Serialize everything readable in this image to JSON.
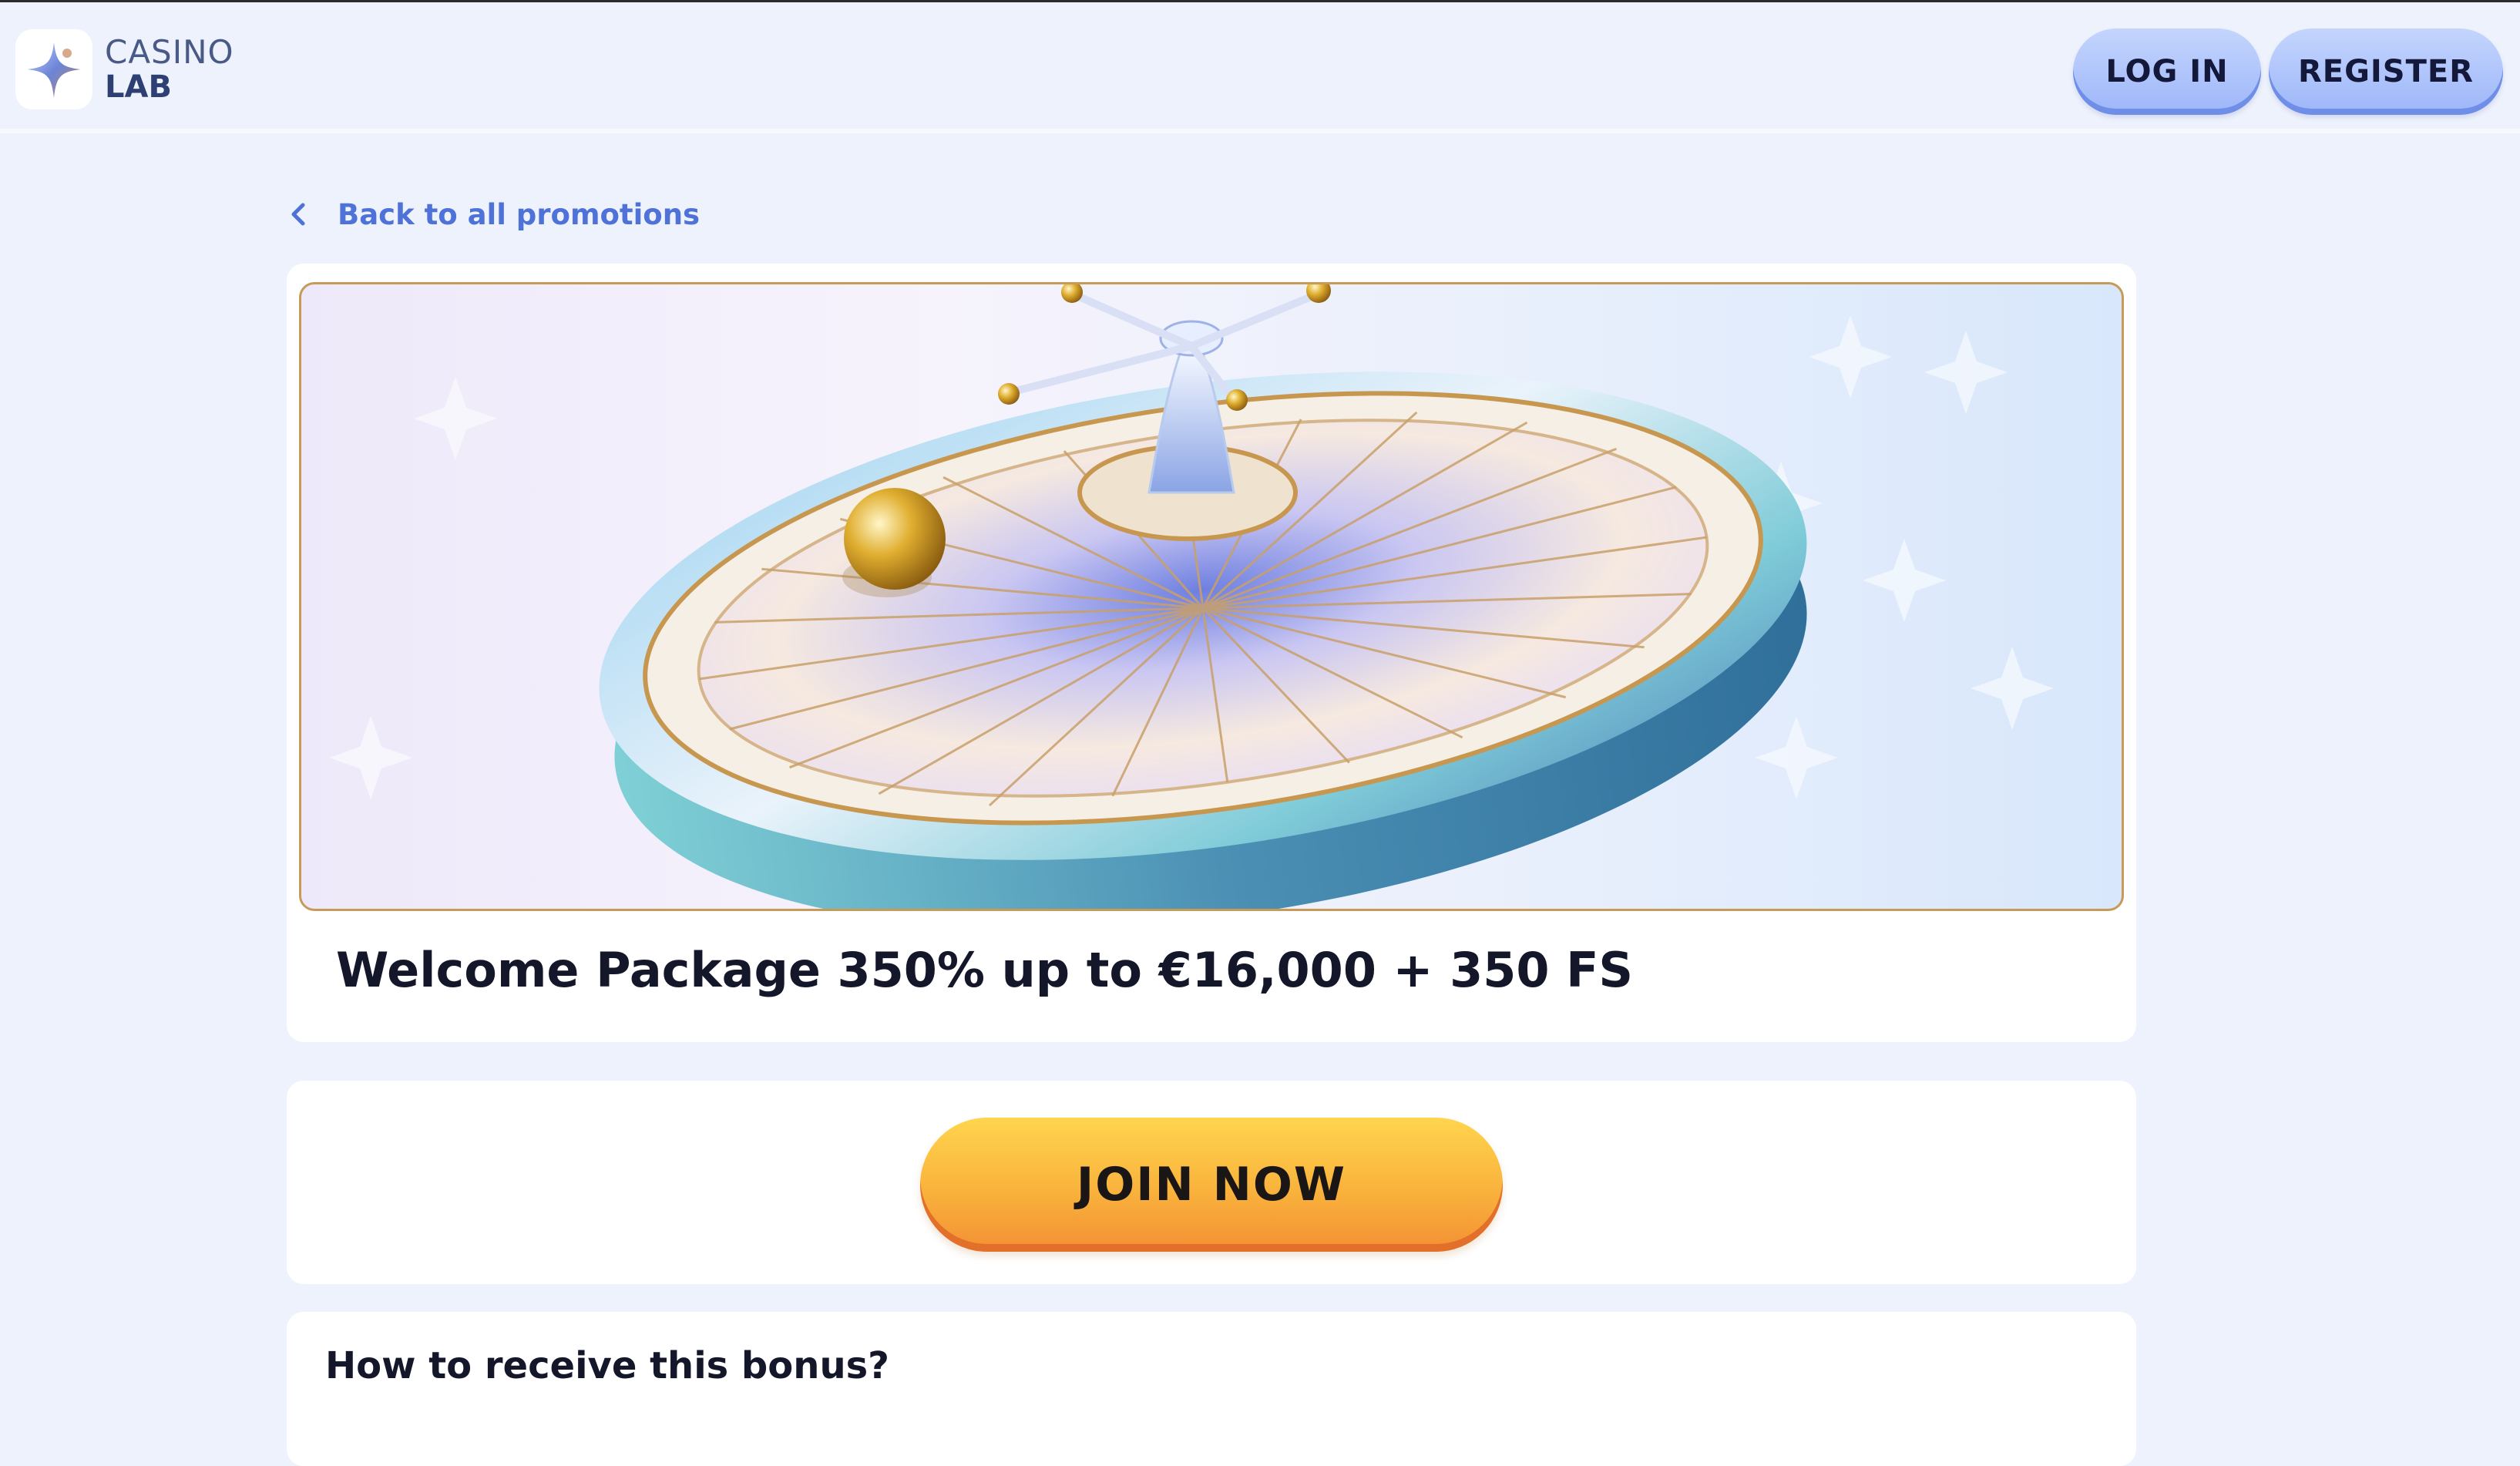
{
  "header": {
    "logo": {
      "line1": "CASINO",
      "line2": "LAB",
      "icon": "sparkle-star-icon"
    },
    "login_label": "LOG IN",
    "register_label": "REGISTER"
  },
  "back_link": {
    "icon": "chevron-left-icon",
    "label": "Back to all promotions"
  },
  "promo": {
    "banner_image": "roulette-wheel-image",
    "title": "Welcome Package 350% up to €16,000 + 350 FS"
  },
  "cta": {
    "join_label": "JOIN NOW"
  },
  "how_section": {
    "title": "How to receive this bonus?"
  },
  "colors": {
    "page_bg": "#eef2fd",
    "header_button": "#a9bffa",
    "link": "#4f72d9",
    "cta_top": "#ffd54e",
    "cta_bottom": "#f39033",
    "banner_border": "#c79a5a"
  }
}
